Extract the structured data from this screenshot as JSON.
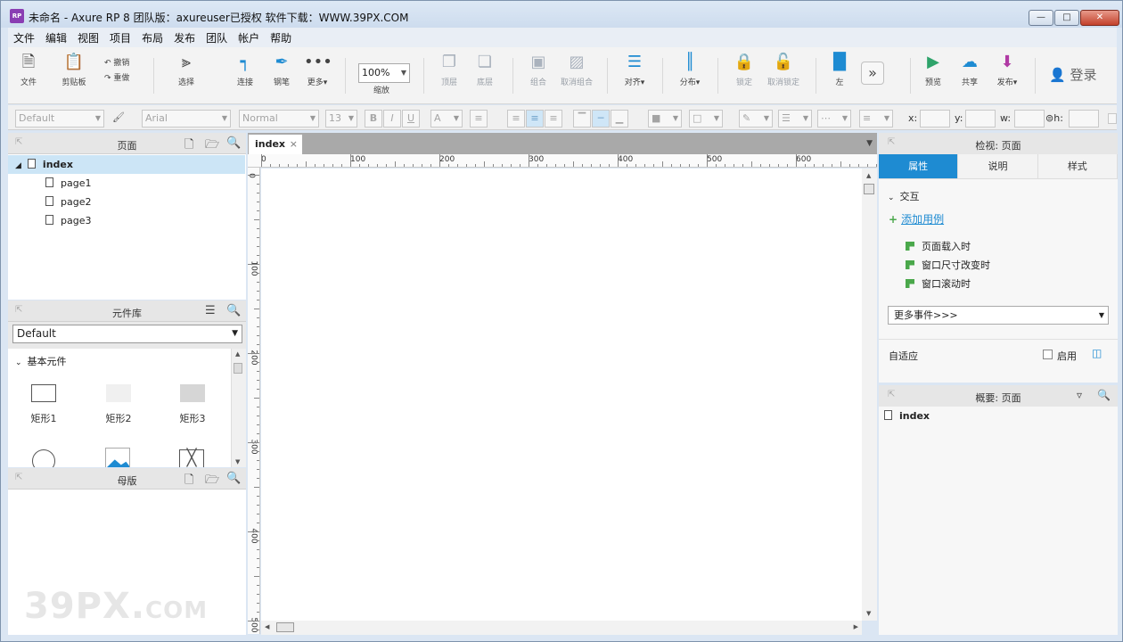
{
  "window": {
    "title": "未命名 - Axure RP 8 团队版：axureuser已授权 软件下载：WWW.39PX.COM",
    "app_icon": "RP",
    "min_icon": "minimize-icon",
    "max_icon": "maximize-icon",
    "close_icon": "close-icon"
  },
  "menu": [
    "文件",
    "编辑",
    "视图",
    "项目",
    "布局",
    "发布",
    "团队",
    "帐户",
    "帮助"
  ],
  "toolbar": {
    "file": "文件",
    "clipboard": "剪贴板",
    "undo": "撤销",
    "redo": "重做",
    "select": "选择",
    "connect": "连接",
    "pen": "钢笔",
    "more": "更多▾",
    "zoom_value": "100%",
    "zoom_label": "缩放",
    "top": "顶层",
    "bottom": "底层",
    "group": "组合",
    "ungroup": "取消组合",
    "align": "对齐▾",
    "distribute": "分布▾",
    "lock": "锁定",
    "unlock": "取消锁定",
    "left": "左",
    "preview": "预览",
    "share": "共享",
    "publish": "发布▾",
    "login": "登录"
  },
  "format": {
    "style": "Default",
    "font": "Arial",
    "weight": "Normal",
    "size": "13",
    "bold": "B",
    "italic": "I",
    "underline": "U",
    "font_color": "A",
    "x_label": "x:",
    "y_label": "y:",
    "w_label": "w:",
    "h_label": "h:"
  },
  "pages_panel": {
    "title": "页面",
    "items": [
      {
        "label": "index",
        "level": 0
      },
      {
        "label": "page1",
        "level": 1
      },
      {
        "label": "page2",
        "level": 1
      },
      {
        "label": "page3",
        "level": 1
      }
    ]
  },
  "library_panel": {
    "title": "元件库",
    "selected_library": "Default",
    "section": "基本元件",
    "widgets": [
      "矩形1",
      "矩形2",
      "矩形3"
    ]
  },
  "masters_panel": {
    "title": "母版"
  },
  "canvas": {
    "tab": "index",
    "ruler_h": [
      "0",
      "100",
      "200",
      "300",
      "400",
      "500",
      "600"
    ],
    "ruler_v": [
      "0",
      "100",
      "200",
      "300",
      "400",
      "500"
    ]
  },
  "inspector": {
    "title": "检视: 页面",
    "tabs": [
      "属性",
      "说明",
      "样式"
    ],
    "section": "交互",
    "add_case": "添加用例",
    "events": [
      "页面载入时",
      "窗口尺寸改变时",
      "窗口滚动时"
    ],
    "more_events": "更多事件>>>",
    "adaptive": "自适应",
    "enable": "启用"
  },
  "overview": {
    "title": "概要: 页面",
    "item": "index"
  },
  "watermark": {
    "main": "39PX.",
    "suffix": "COM"
  },
  "colors": {
    "accent": "#1e8bd2",
    "selection": "#cce5f6",
    "event_flag": "#4aa84b"
  }
}
